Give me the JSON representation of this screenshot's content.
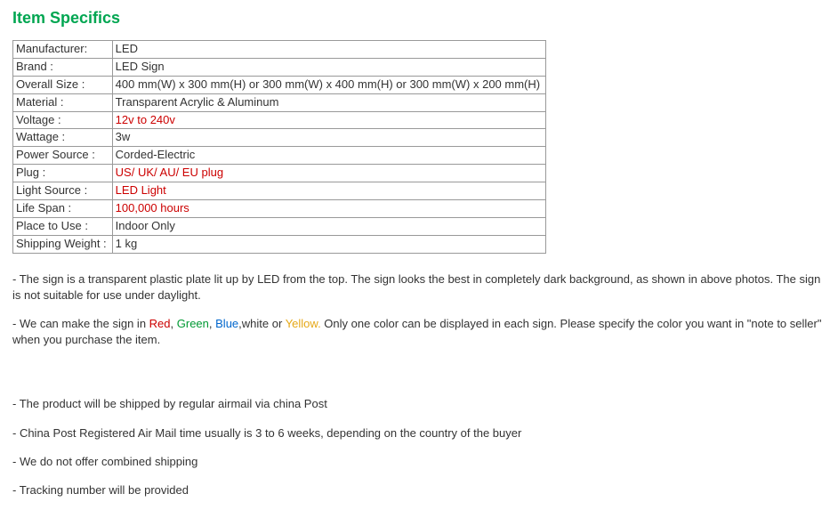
{
  "heading": "Item Specifics",
  "specs": [
    {
      "label": "Manufacturer:",
      "value": "LED",
      "red": false
    },
    {
      "label": "Brand :",
      "value": "LED  Sign",
      "red": false
    },
    {
      "label": "Overall Size :",
      "value": "400 mm(W) x 300 mm(H) or 300 mm(W) x 400 mm(H) or 300 mm(W) x 200 mm(H)",
      "red": false
    },
    {
      "label": "Material :",
      "value": "Transparent Acrylic & Aluminum",
      "red": false
    },
    {
      "label": "Voltage :",
      "value": "12v to 240v",
      "red": true
    },
    {
      "label": "Wattage :",
      "value": "3w",
      "red": false
    },
    {
      "label": "Power Source :",
      "value": "Corded-Electric",
      "red": false
    },
    {
      "label": "Plug :",
      "value": "US/ UK/ AU/ EU plug",
      "red": true
    },
    {
      "label": "Light Source :",
      "value": "LED Light",
      "red": true
    },
    {
      "label": "Life Span :",
      "value": "100,000 hours",
      "red": true
    },
    {
      "label": "Place to Use :",
      "value": "Indoor Only",
      "red": false
    },
    {
      "label": "Shipping Weight :",
      "value": "1 kg",
      "red": false
    }
  ],
  "p1": "- The sign is a transparent plastic plate lit up by LED from the top. The sign looks the best in completely dark background, as shown in above photos. The sign is not suitable for use under daylight.",
  "p2_pre": "- We can make the sign in ",
  "p2_red": "Red",
  "p2_c1": ", ",
  "p2_green": "Green",
  "p2_c2": ", ",
  "p2_blue": "Blue",
  "p2_mid": ",white or ",
  "p2_yellow": "Yellow.",
  "p2_post": " Only one color can be displayed in each sign. Please specify the color you want in \"note to seller\" when you purchase the item.",
  "p3": "- The product will be shipped by regular airmail via china Post",
  "p4": "- China Post Registered Air Mail time usually is 3 to 6 weeks, depending on the country of the buyer",
  "p5": "- We do not offer combined shipping",
  "p6": "- Tracking number will be provided"
}
